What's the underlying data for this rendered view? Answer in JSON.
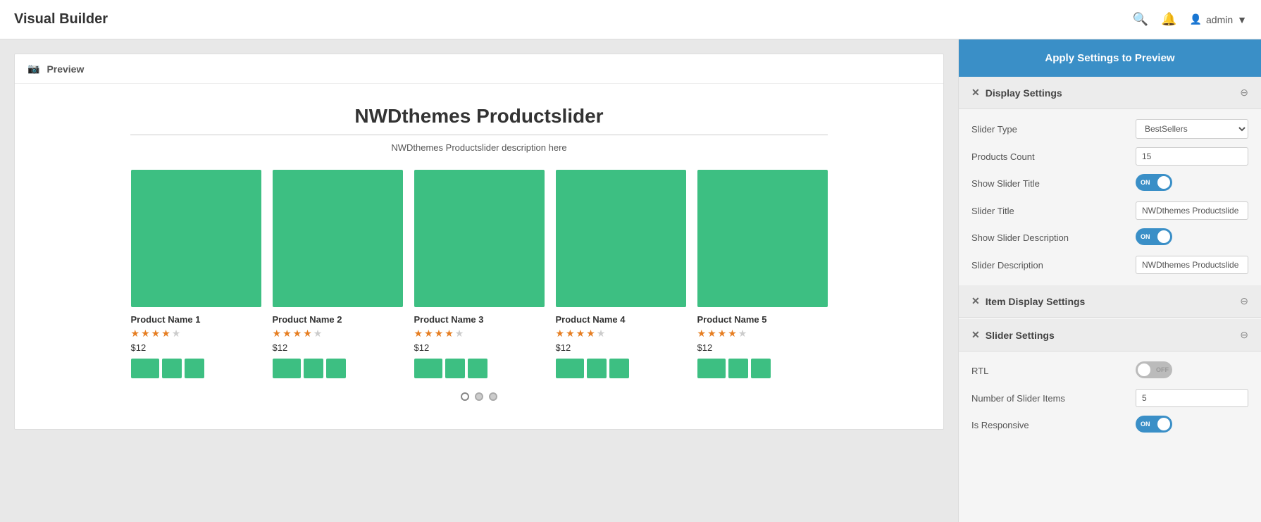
{
  "navbar": {
    "brand": "Visual Builder",
    "user": "admin",
    "icons": {
      "search": "🔍",
      "bell": "🔔",
      "user": "👤"
    }
  },
  "preview": {
    "header": "Preview",
    "slider_title": "NWDthemes Productslider",
    "slider_description": "NWDthemes Productslider description here",
    "products": [
      {
        "name": "Product Name 1",
        "rating": 4,
        "price": "$12",
        "stars": [
          true,
          true,
          true,
          true,
          false
        ]
      },
      {
        "name": "Product Name 2",
        "rating": 4,
        "price": "$12",
        "stars": [
          true,
          true,
          true,
          true,
          false
        ]
      },
      {
        "name": "Product Name 3",
        "rating": 4,
        "price": "$12",
        "stars": [
          true,
          true,
          true,
          true,
          false
        ]
      },
      {
        "name": "Product Name 4",
        "rating": 4,
        "price": "$12",
        "stars": [
          true,
          true,
          true,
          true,
          false
        ]
      },
      {
        "name": "Product Name 5",
        "rating": 4,
        "price": "$12",
        "stars": [
          true,
          true,
          true,
          true,
          false
        ]
      }
    ]
  },
  "right_panel": {
    "apply_button": "Apply Settings to Preview",
    "display_settings": {
      "title": "Display Settings",
      "fields": {
        "slider_type_label": "Slider Type",
        "slider_type_value": "BestSellers",
        "products_count_label": "Products Count",
        "products_count_value": "15",
        "show_slider_title_label": "Show Slider Title",
        "show_slider_title_value": true,
        "slider_title_label": "Slider Title",
        "slider_title_value": "NWDthemes Productslide",
        "show_slider_desc_label": "Show Slider Description",
        "show_slider_desc_value": true,
        "slider_desc_label": "Slider Description",
        "slider_desc_value": "NWDthemes Productslide"
      }
    },
    "item_display_settings": {
      "title": "Item Display Settings"
    },
    "slider_settings": {
      "title": "Slider Settings",
      "fields": {
        "rtl_label": "RTL",
        "rtl_value": false,
        "slider_items_label": "Number of Slider Items",
        "slider_items_value": "5",
        "is_responsive_label": "Is Responsive",
        "is_responsive_value": true
      }
    }
  }
}
